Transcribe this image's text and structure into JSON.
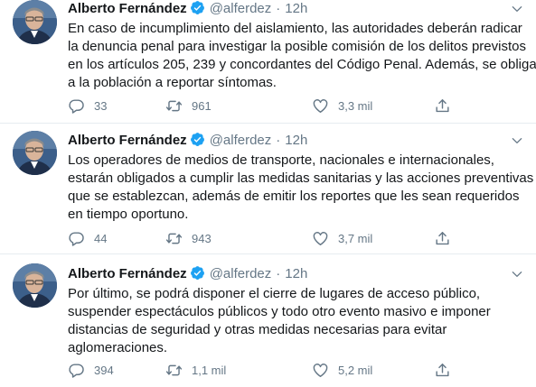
{
  "colors": {
    "text": "#14171a",
    "secondary": "#657786",
    "verified": "#1da1f2",
    "divider": "#e6ecf0"
  },
  "tweets": [
    {
      "author": {
        "name": "Alberto Fernández",
        "handle": "@alferdez",
        "verified": true,
        "avatar_icon": "user-avatar"
      },
      "separator": "·",
      "time": "12h",
      "text_lines": [
        "En caso de incumplimiento del aislamiento, las autoridades deberán radicar",
        "la denuncia penal para investigar la posible comisión de los delitos previstos",
        "en los artículos 205, 239 y concordantes del Código Penal. Además, se obliga",
        "a la población a reportar síntomas."
      ],
      "stats": {
        "replies": "33",
        "retweets": "961",
        "likes": "3,3 mil"
      }
    },
    {
      "author": {
        "name": "Alberto Fernández",
        "handle": "@alferdez",
        "verified": true,
        "avatar_icon": "user-avatar"
      },
      "separator": "·",
      "time": "12h",
      "text_lines": [
        "Los operadores de medios de transporte, nacionales e internacionales,",
        "estarán obligados a cumplir las medidas sanitarias y las acciones preventivas",
        "que se establezcan, además de emitir los reportes que les sean requeridos",
        "en tiempo oportuno."
      ],
      "stats": {
        "replies": "44",
        "retweets": "943",
        "likes": "3,7 mil"
      }
    },
    {
      "author": {
        "name": "Alberto Fernández",
        "handle": "@alferdez",
        "verified": true,
        "avatar_icon": "user-avatar"
      },
      "separator": "·",
      "time": "12h",
      "text_lines": [
        "Por último, se podrá disponer el cierre de lugares de acceso público,",
        "suspender espectáculos públicos y todo otro evento masivo e imponer",
        "distancias de seguridad y otras medidas necesarias para evitar",
        "aglomeraciones."
      ],
      "stats": {
        "replies": "394",
        "retweets": "1,1 mil",
        "likes": "5,2 mil"
      }
    }
  ]
}
